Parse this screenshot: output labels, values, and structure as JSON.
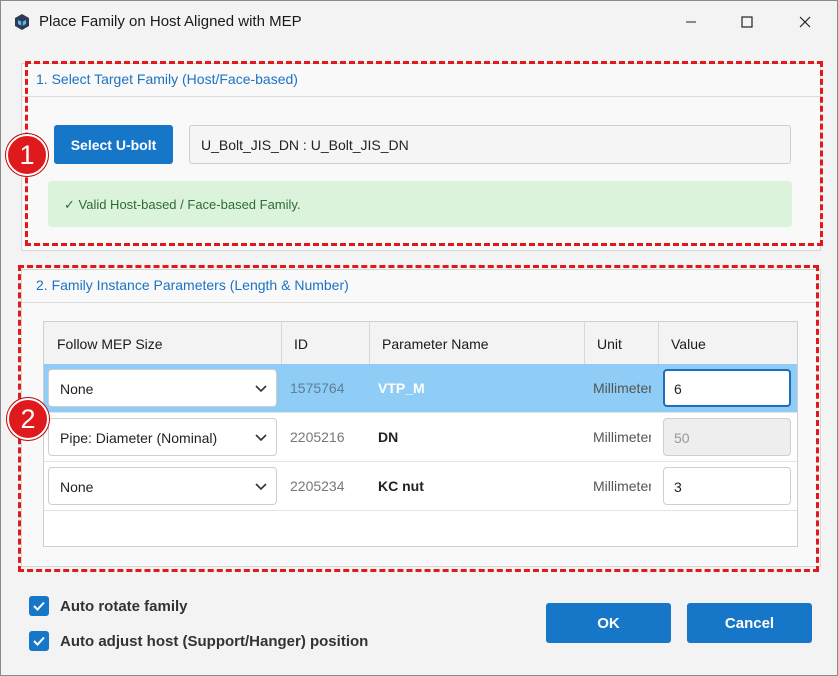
{
  "window": {
    "title": "Place Family on Host Aligned with MEP"
  },
  "section1": {
    "title": "1. Select Target Family (Host/Face-based)",
    "select_button": "Select U-bolt",
    "family_value": "U_Bolt_JIS_DN : U_Bolt_JIS_DN",
    "validation_message": "✓ Valid Host-based / Face-based Family."
  },
  "section2": {
    "title": "2. Family Instance Parameters (Length & Number)",
    "columns": [
      "Follow MEP Size",
      "ID",
      "Parameter Name",
      "Unit",
      "Value"
    ],
    "rows": [
      {
        "follow": "None",
        "id": "1575764",
        "name": "VTP_M",
        "unit": "Millimeters",
        "value": "6",
        "selected": true,
        "editable": true
      },
      {
        "follow": "Pipe: Diameter (Nominal)",
        "id": "2205216",
        "name": "DN",
        "unit": "Millimeters",
        "value": "50",
        "selected": false,
        "editable": false
      },
      {
        "follow": "None",
        "id": "2205234",
        "name": "KC nut",
        "unit": "Millimeters",
        "value": "3",
        "selected": false,
        "editable": true
      }
    ]
  },
  "options": {
    "auto_rotate": {
      "label": "Auto rotate family",
      "checked": true
    },
    "auto_adjust": {
      "label": "Auto adjust host (Support/Hanger) position",
      "checked": true
    }
  },
  "buttons": {
    "ok": "OK",
    "cancel": "Cancel"
  },
  "annotations": {
    "badge1": "1",
    "badge2": "2"
  },
  "colors": {
    "accent": "#1677c9",
    "annotation": "#e0191c",
    "selected_row": "#8fcdf7",
    "success_bg": "#dcf3db"
  }
}
